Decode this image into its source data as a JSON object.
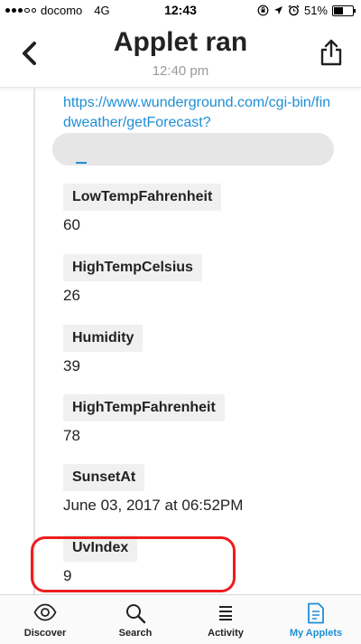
{
  "status_bar": {
    "carrier": "docomo",
    "network": "4G",
    "time": "12:43",
    "battery": "51%",
    "battery_level": 0.51
  },
  "header": {
    "title": "Applet ran",
    "subtitle": "12:40 pm",
    "icons": {
      "back": "chevron-left-icon",
      "share": "share-icon"
    }
  },
  "content": {
    "url_text": "https://www.wunderground.com/cgi-bin/findweather/getForecast?",
    "fields": [
      {
        "label": "LowTempFahrenheit",
        "value": "60"
      },
      {
        "label": "HighTempCelsius",
        "value": "26"
      },
      {
        "label": "Humidity",
        "value": "39"
      },
      {
        "label": "HighTempFahrenheit",
        "value": "78"
      },
      {
        "label": "SunsetAt",
        "value": "June 03, 2017 at 06:52PM"
      },
      {
        "label": "UvIndex",
        "value": "9"
      }
    ]
  },
  "tabbar": {
    "tabs": [
      {
        "label": "Discover",
        "icon": "eye-icon"
      },
      {
        "label": "Search",
        "icon": "search-icon"
      },
      {
        "label": "Activity",
        "icon": "list-icon"
      },
      {
        "label": "My Applets",
        "icon": "document-icon"
      }
    ],
    "active": "My Applets"
  },
  "colors": {
    "accent": "#1e8fd6",
    "highlight": "#ee1c1c",
    "label_bg": "#f0f0f0"
  }
}
